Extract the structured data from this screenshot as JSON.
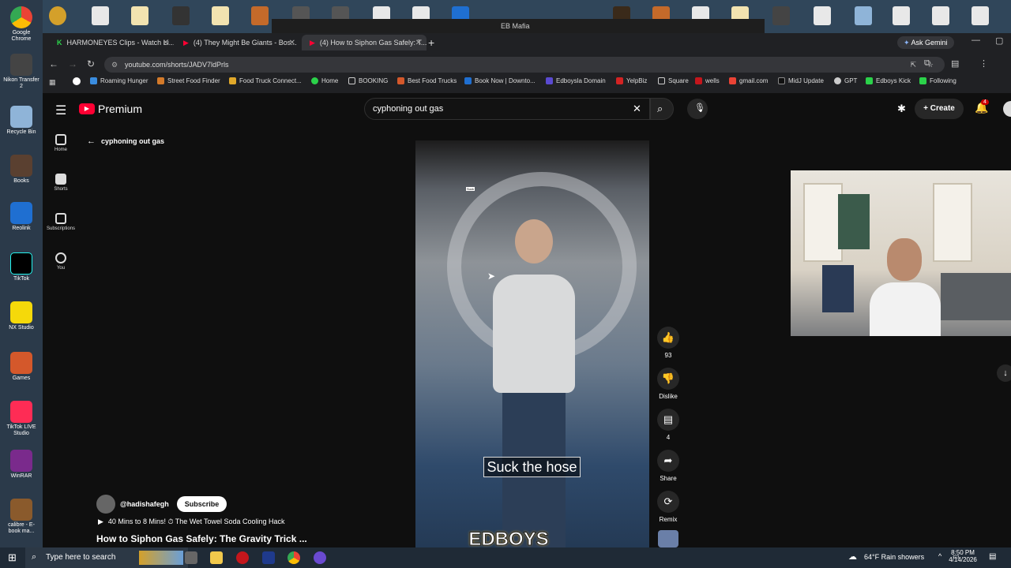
{
  "desktop": {
    "icons": [
      "Google Chrome",
      "Nikon Transfer 2",
      "Recycle Bin",
      "Books",
      "Reolink",
      "TikTok",
      "NX Studio",
      "Games",
      "TikTok LIVE Studio",
      "WinRAR",
      "calibre - E-book ma..."
    ]
  },
  "eb_window_title": "EB Mafia",
  "browser": {
    "tabs": [
      {
        "label": "HARMONEYES Clips - Watch Li...",
        "active": false
      },
      {
        "label": "(4) They Might Be Giants - Bos...",
        "active": false
      },
      {
        "label": "(4) How to Siphon Gas Safely: T...",
        "active": true
      }
    ],
    "gemini": "Ask Gemini",
    "url": "youtube.com/shorts/JADV7ldPrls",
    "bookmarks": [
      "Roaming Hunger",
      "Street Food Finder",
      "Food Truck Connect...",
      "Home",
      "BOOKING",
      "Best Food Trucks",
      "Book Now | Downto...",
      "Edboysla Domain",
      "YelpBiz",
      "Square",
      "wells",
      "gmail.com",
      "MidJ Update",
      "GPT",
      "Edboys Kick",
      "Following"
    ]
  },
  "youtube": {
    "brand": "Premium",
    "search_value": "cyphoning out gas",
    "create_label": "Create",
    "notif_count": "4",
    "sidebar": [
      "Home",
      "Shorts",
      "Subscriptions",
      "You"
    ],
    "back_label": "cyphoning out gas",
    "video": {
      "top_text": "Suck",
      "caption": "Suck the hose",
      "watermark": "EDBOYS"
    },
    "actions": {
      "like_count": "93",
      "dislike_label": "Dislike",
      "comment_count": "4",
      "share_label": "Share",
      "remix_label": "Remix"
    },
    "channel": "@hadishafegh",
    "subscribe_label": "Subscribe",
    "playlist_line": "40 Mins to 8 Mins! ⏱ The Wet Towel Soda Cooling Hack",
    "title": "How to Siphon Gas Safely: The Gravity Trick ..."
  },
  "taskbar": {
    "search_placeholder": "Type here to search",
    "weather": "64°F  Rain showers",
    "time": "8:50 PM",
    "date": "4/14/2026"
  },
  "colors": {
    "yt_red": "#ff0033",
    "chrome_bg": "#202124",
    "yt_bg": "#0f0f0f"
  }
}
